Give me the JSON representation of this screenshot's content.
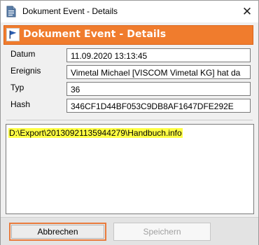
{
  "window": {
    "title": "Dokument Event - Details",
    "close_glyph": "✕"
  },
  "banner": {
    "title": "Dokument Event - Details",
    "color": "#f07c2d"
  },
  "fields": {
    "datum": {
      "label": "Datum",
      "value": "11.09.2020 13:13:45"
    },
    "ereignis": {
      "label": "Ereignis",
      "value": "Vimetal Michael [VISCOM Vimetal KG] hat da"
    },
    "typ": {
      "label": "Typ",
      "value": "36"
    },
    "hash": {
      "label": "Hash",
      "value": "346CF1D44BF053C9DB8AF1647DFE292E"
    }
  },
  "details": {
    "text": "D:\\Export\\20130921135944279\\Handbuch.info",
    "highlight_color": "#ffff44"
  },
  "buttons": {
    "cancel": "Abbrechen",
    "save": "Speichern"
  }
}
